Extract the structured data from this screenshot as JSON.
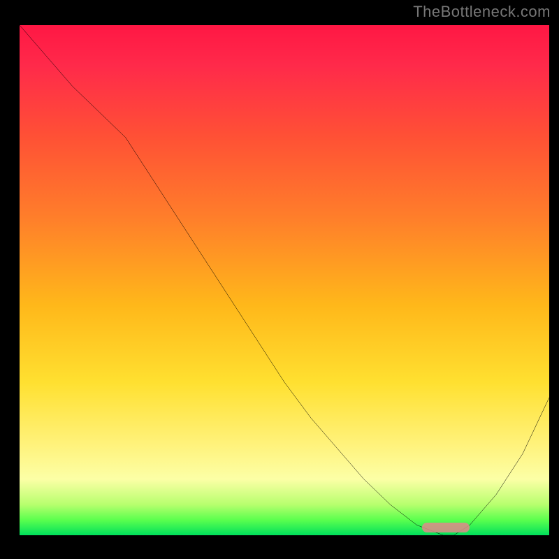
{
  "watermark": "TheBottleneck.com",
  "chart_data": {
    "type": "line",
    "title": "",
    "xlabel": "",
    "ylabel": "",
    "x": [
      0.0,
      0.05,
      0.1,
      0.15,
      0.2,
      0.25,
      0.3,
      0.35,
      0.4,
      0.45,
      0.5,
      0.55,
      0.6,
      0.65,
      0.7,
      0.75,
      0.8,
      0.82,
      0.85,
      0.9,
      0.95,
      1.0
    ],
    "values": [
      1.0,
      0.94,
      0.88,
      0.83,
      0.78,
      0.7,
      0.62,
      0.54,
      0.46,
      0.38,
      0.3,
      0.23,
      0.17,
      0.11,
      0.06,
      0.02,
      0.0,
      0.0,
      0.02,
      0.08,
      0.16,
      0.27
    ],
    "ylim": [
      0,
      1
    ],
    "xlim": [
      0,
      1
    ],
    "marker_range_x": [
      0.76,
      0.85
    ],
    "gradient_stops": [
      {
        "pos": 0.0,
        "color": "#ff1744"
      },
      {
        "pos": 0.55,
        "color": "#ffb81a"
      },
      {
        "pos": 1.0,
        "color": "#00e05c"
      }
    ]
  }
}
